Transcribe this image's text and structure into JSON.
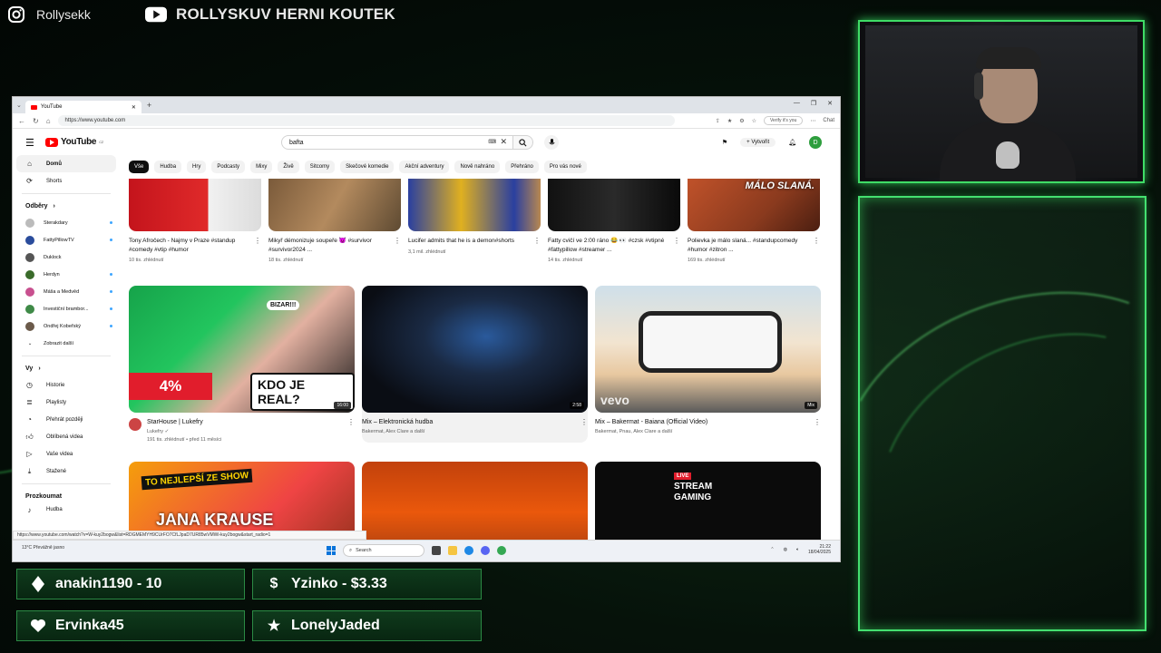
{
  "social": {
    "instagram_handle": "Rollysekk",
    "youtube_channel": "ROLLYSKUV HERNI KOUTEK"
  },
  "browser": {
    "tab_title": "YouTube",
    "url": "https://www.youtube.com",
    "verify_label": "Verify it's you",
    "chat_label": "Chat"
  },
  "youtube": {
    "logo_text": "YouTube",
    "logo_region": "CZ",
    "search_value": "bafta",
    "create_label": "Vytvořit",
    "avatar_letter": "D",
    "chips": [
      "Vše",
      "Hudba",
      "Hry",
      "Podcasty",
      "Mixy",
      "Živě",
      "Sitcomy",
      "Skečové komedie",
      "Akční adventury",
      "Nově nahráno",
      "Přehráno",
      "Pro vás nové"
    ],
    "sidebar": {
      "home": "Domů",
      "shorts": "Shorts",
      "subs_header": "Odběry",
      "subs": [
        "Sterakdary",
        "FattyPillowTV",
        "Duklock",
        "Herdyn",
        "Máša a Medvěd",
        "Investiční brambor...",
        "Ondřej Kobeřský"
      ],
      "show_more": "Zobrazit další",
      "you_header": "Vy",
      "you_items": [
        "Historie",
        "Playlisty",
        "Přehrát později",
        "Oblíbená videa",
        "Vaše videa",
        "Stažené"
      ],
      "explore_header": "Prozkoumat",
      "explore_items": [
        "Hudba"
      ]
    },
    "shorts": [
      {
        "title": "Tony Afročech - Najmy v Praze #standup #comedy #vtip #humor",
        "views": "10 tis. zhlédnutí"
      },
      {
        "title": "Mikyř démonizuje soupeře 😈 #survivor #survivor2024 ...",
        "views": "18 tis. zhlédnutí"
      },
      {
        "title": "Lucifer admits that he is a demon#shorts",
        "views": "3,1 mil. zhlédnutí"
      },
      {
        "title": "Fatty cvičí ve 2:00 ráno 😂 👀 #czsk #vtipné #fattypillow #streamer ...",
        "views": "14 tis. zhlédnutí"
      },
      {
        "title": "Polievka je málo slaná... #standupcomedy #humor #zitron ...",
        "views": "169 tis. zhlédnutí",
        "overlay": "MÁLO SLANÁ."
      }
    ],
    "videos": [
      {
        "title": "StarHouse | Lukefry",
        "channel": "Lukefry ✓",
        "meta": "191 tis. zhlédnutí • před 11 měsíci",
        "duration": "16:00",
        "thumb_text": [
          "4%",
          "KDO JE REAL?",
          "BIZAR!!!"
        ]
      },
      {
        "title": "Mix – Elektronická hudba",
        "channel": "Bakermat, Alex Clare a další",
        "meta": "",
        "duration": "2:58"
      },
      {
        "title": "Mix – Bakermat - Baiana (Official Video)",
        "channel": "Bakermat, Pnau, Alex Clare a další",
        "meta": "",
        "duration": "Mix",
        "thumb_text": [
          "vevo"
        ]
      }
    ],
    "row3": [
      {
        "thumb_text": [
          "TO NEJLEPŠÍ ZE SHOW",
          "JANA KRAUSE"
        ]
      },
      {
        "thumb_text": []
      },
      {
        "thumb_text": [
          "LIVE",
          "STREAM",
          "GAMING"
        ]
      }
    ],
    "status_url": "https://www.youtube.com/watch?v=W-kuy2bogw&list=RDGMEMYH9CUrFO7CfLJpaD7UR85wVMWi-kuy2bogw&start_radio=1"
  },
  "taskbar": {
    "weather": "13°C Převážně jasno",
    "search_placeholder": "Search",
    "time": "21:22",
    "date": "18/04/2025"
  },
  "alerts": [
    {
      "text": "anakin1190 - 10",
      "icon": "diamond-icon"
    },
    {
      "text": "Yzinko - $3.33",
      "icon": "dollar-icon"
    },
    {
      "text": "Ervinka45",
      "icon": "heart-icon"
    },
    {
      "text": "LonelyJaded",
      "icon": "star-icon"
    }
  ]
}
